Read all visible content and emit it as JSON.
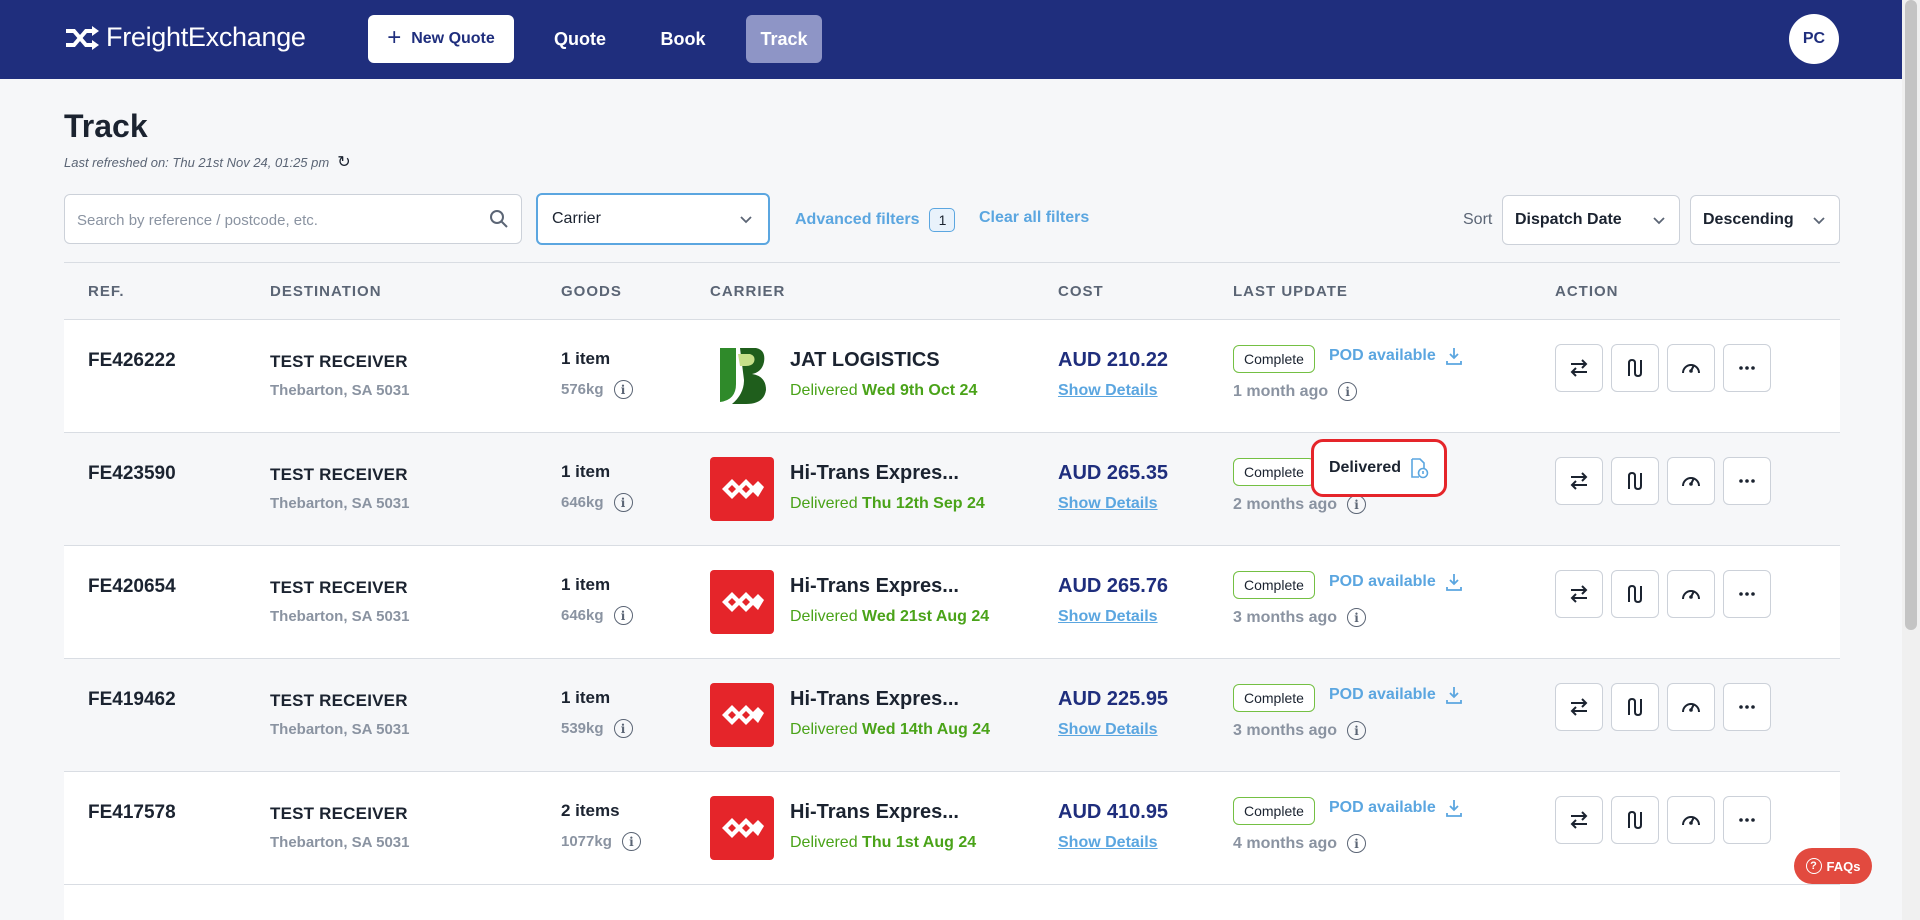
{
  "header": {
    "brand": "FreightExchange",
    "new_quote_label": "New Quote",
    "nav": {
      "quote": "Quote",
      "book": "Book",
      "track": "Track"
    },
    "avatar_initials": "PC"
  },
  "page": {
    "title": "Track",
    "last_refreshed": "Last refreshed on: Thu 21st Nov 24, 01:25 pm"
  },
  "filters": {
    "search_placeholder": "Search by reference / postcode, etc.",
    "carrier_value": "Carrier",
    "advanced_label": "Advanced filters",
    "advanced_count": "1",
    "clear_label": "Clear all filters",
    "sort_label": "Sort",
    "sort_field": "Dispatch Date",
    "sort_order": "Descending"
  },
  "table": {
    "headers": {
      "ref": "REF.",
      "destination": "DESTINATION",
      "goods": "GOODS",
      "carrier": "CARRIER",
      "cost": "COST",
      "last_update": "LAST UPDATE",
      "action": "ACTION"
    },
    "rows": [
      {
        "ref": "FE426222",
        "dest_name": "TEST RECEIVER",
        "dest_addr": "Thebarton, SA 5031",
        "goods": "1 item",
        "weight": "576kg",
        "carrier": "JAT LOGISTICS",
        "status": "Delivered",
        "status_date": "Wed 9th Oct 24",
        "cost": "AUD 210.22",
        "details": "Show Details",
        "badge": "Complete",
        "pod": "POD available",
        "ago": "1 month ago"
      },
      {
        "ref": "FE423590",
        "dest_name": "TEST RECEIVER",
        "dest_addr": "Thebarton, SA 5031",
        "goods": "1 item",
        "weight": "646kg",
        "carrier": "Hi-Trans Expres...",
        "status": "Delivered",
        "status_date": "Thu 12th Sep 24",
        "cost": "AUD 265.35",
        "details": "Show Details",
        "badge": "Complete",
        "pod": "",
        "ago": "2 months ago"
      },
      {
        "ref": "FE420654",
        "dest_name": "TEST RECEIVER",
        "dest_addr": "Thebarton, SA 5031",
        "goods": "1 item",
        "weight": "646kg",
        "carrier": "Hi-Trans Expres...",
        "status": "Delivered",
        "status_date": "Wed 21st Aug 24",
        "cost": "AUD 265.76",
        "details": "Show Details",
        "badge": "Complete",
        "pod": "POD available",
        "ago": "3 months ago"
      },
      {
        "ref": "FE419462",
        "dest_name": "TEST RECEIVER",
        "dest_addr": "Thebarton, SA 5031",
        "goods": "1 item",
        "weight": "539kg",
        "carrier": "Hi-Trans Expres...",
        "status": "Delivered",
        "status_date": "Wed 14th Aug 24",
        "cost": "AUD 225.95",
        "details": "Show Details",
        "badge": "Complete",
        "pod": "POD available",
        "ago": "3 months ago"
      },
      {
        "ref": "FE417578",
        "dest_name": "TEST RECEIVER",
        "dest_addr": "Thebarton, SA 5031",
        "goods": "2 items",
        "weight": "1077kg",
        "carrier": "Hi-Trans Expres...",
        "status": "Delivered",
        "status_date": "Thu 1st Aug 24",
        "cost": "AUD 410.95",
        "details": "Show Details",
        "badge": "Complete",
        "pod": "POD available",
        "ago": "4 months ago"
      }
    ]
  },
  "tooltip": {
    "label": "Delivered"
  },
  "faq_label": "FAQs",
  "colors": {
    "header_bg": "#1f2e7d",
    "accent_blue": "#5ba6e0",
    "delivered_green": "#4aa319",
    "hitrans_red": "#e5252a",
    "highlight_red": "#e5252a"
  },
  "icons": [
    "shuffle-logo-icon",
    "plus-icon",
    "refresh-icon",
    "search-icon",
    "chevron-down-icon",
    "info-icon",
    "download-icon",
    "swap-icon",
    "route-icon",
    "gauge-icon",
    "more-icon",
    "document-info-icon",
    "question-icon"
  ]
}
